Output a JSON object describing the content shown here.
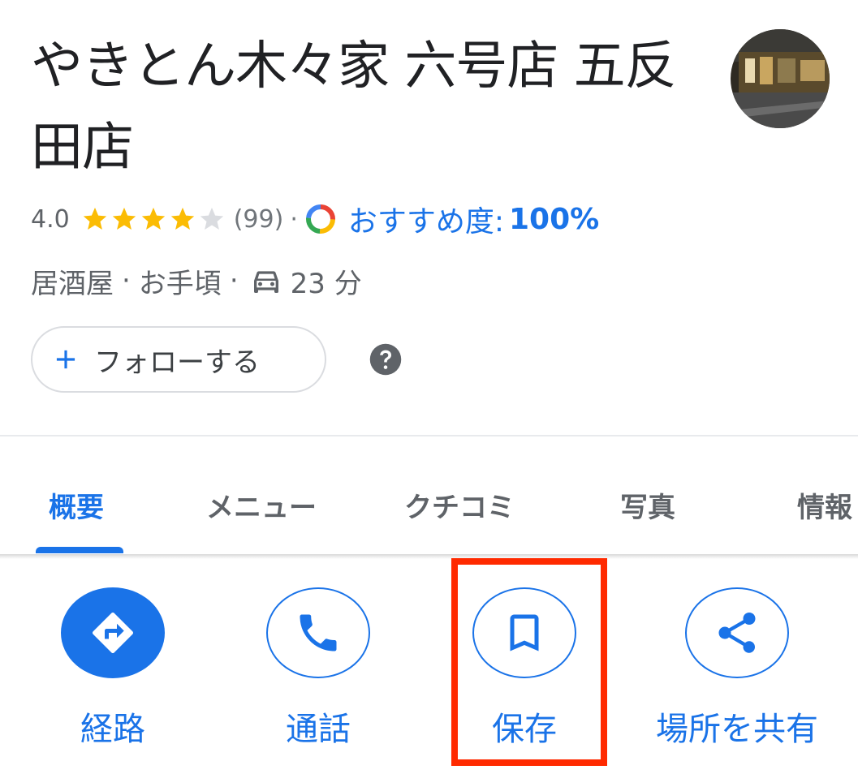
{
  "place": {
    "title": "やきとん木々家 六号店 五反田店"
  },
  "rating": {
    "value": "4.0",
    "stars": 4,
    "review_count": "(99)",
    "separator": "·",
    "recommend_label": "おすすめ度:",
    "recommend_value": "100%"
  },
  "meta": {
    "category": "居酒屋",
    "price": "お手頃",
    "dot": "·",
    "drive_time": "23 分"
  },
  "follow": {
    "label": "フォローする"
  },
  "tabs": [
    {
      "label": "概要",
      "active": true
    },
    {
      "label": "メニュー",
      "active": false
    },
    {
      "label": "クチコミ",
      "active": false
    },
    {
      "label": "写真",
      "active": false
    },
    {
      "label": "情報",
      "active": false
    }
  ],
  "actions": [
    {
      "label": "経路",
      "icon": "directions-icon"
    },
    {
      "label": "通話",
      "icon": "phone-icon"
    },
    {
      "label": "保存",
      "icon": "bookmark-icon"
    },
    {
      "label": "場所を共有",
      "icon": "share-icon"
    }
  ],
  "colors": {
    "accent": "#1a73e8",
    "star": "#fbbc04",
    "highlight": "#ff2a00"
  }
}
